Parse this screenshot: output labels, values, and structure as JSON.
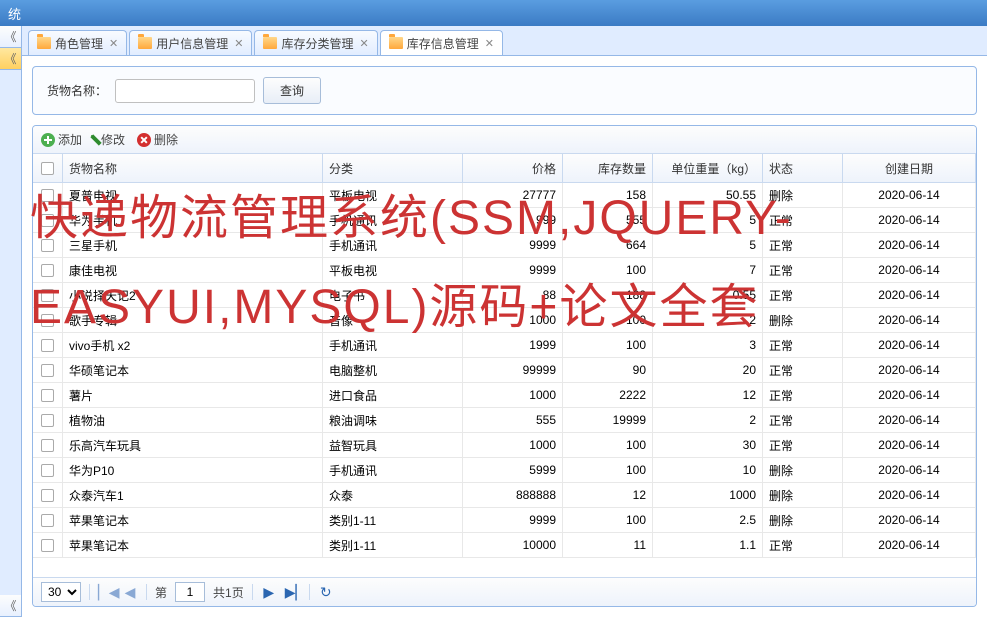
{
  "window": {
    "title_suffix": "统"
  },
  "tabs": [
    {
      "label": "角色管理"
    },
    {
      "label": "用户信息管理"
    },
    {
      "label": "库存分类管理"
    },
    {
      "label": "库存信息管理",
      "active": true
    }
  ],
  "search": {
    "label": "货物名称：",
    "query_btn": "查询"
  },
  "toolbar": {
    "add": "添加",
    "edit": "修改",
    "del": "删除"
  },
  "columns": {
    "name": "货物名称",
    "cat": "分类",
    "price": "价格",
    "qty": "库存数量",
    "weight": "单位重量（kg）",
    "status": "状态",
    "date": "创建日期"
  },
  "rows": [
    {
      "name": "夏普电视",
      "cat": "平板电视",
      "price": "27777",
      "qty": "158",
      "weight": "50.55",
      "status": "删除",
      "date": "2020-06-14"
    },
    {
      "name": "华为手机",
      "cat": "手机通讯",
      "price": "999",
      "qty": "555",
      "weight": "5",
      "status": "正常",
      "date": "2020-06-14"
    },
    {
      "name": "三星手机",
      "cat": "手机通讯",
      "price": "9999",
      "qty": "664",
      "weight": "5",
      "status": "正常",
      "date": "2020-06-14"
    },
    {
      "name": "康佳电视",
      "cat": "平板电视",
      "price": "9999",
      "qty": "100",
      "weight": "7",
      "status": "正常",
      "date": "2020-06-14"
    },
    {
      "name": "小说择天记2",
      "cat": "电子书",
      "price": "88",
      "qty": "188",
      "weight": "0.55",
      "status": "正常",
      "date": "2020-06-14"
    },
    {
      "name": "歌手专辑",
      "cat": "音像",
      "price": "1000",
      "qty": "100",
      "weight": "2",
      "status": "删除",
      "date": "2020-06-14"
    },
    {
      "name": "vivo手机 x2",
      "cat": "手机通讯",
      "price": "1999",
      "qty": "100",
      "weight": "3",
      "status": "正常",
      "date": "2020-06-14"
    },
    {
      "name": "华硕笔记本",
      "cat": "电脑整机",
      "price": "99999",
      "qty": "90",
      "weight": "20",
      "status": "正常",
      "date": "2020-06-14"
    },
    {
      "name": "薯片",
      "cat": "进口食品",
      "price": "1000",
      "qty": "2222",
      "weight": "12",
      "status": "正常",
      "date": "2020-06-14"
    },
    {
      "name": "植物油",
      "cat": "粮油调味",
      "price": "555",
      "qty": "19999",
      "weight": "2",
      "status": "正常",
      "date": "2020-06-14"
    },
    {
      "name": "乐高汽车玩具",
      "cat": "益智玩具",
      "price": "1000",
      "qty": "100",
      "weight": "30",
      "status": "正常",
      "date": "2020-06-14"
    },
    {
      "name": "华为P10",
      "cat": "手机通讯",
      "price": "5999",
      "qty": "100",
      "weight": "10",
      "status": "删除",
      "date": "2020-06-14"
    },
    {
      "name": "众泰汽车1",
      "cat": "众泰",
      "price": "888888",
      "qty": "12",
      "weight": "1000",
      "status": "删除",
      "date": "2020-06-14"
    },
    {
      "name": "苹果笔记本",
      "cat": "类别1-11",
      "price": "9999",
      "qty": "100",
      "weight": "2.5",
      "status": "删除",
      "date": "2020-06-14"
    },
    {
      "name": "苹果笔记本",
      "cat": "类别1-11",
      "price": "10000",
      "qty": "11",
      "weight": "1.1",
      "status": "正常",
      "date": "2020-06-14"
    }
  ],
  "pager": {
    "page_size": "30",
    "page_label_prefix": "第",
    "page_value": "1",
    "page_label_suffix": "共1页"
  },
  "watermark": "快递物流管理系统(SSM,JQUERY-EASYUI,MYSQL)源码+论文全套"
}
